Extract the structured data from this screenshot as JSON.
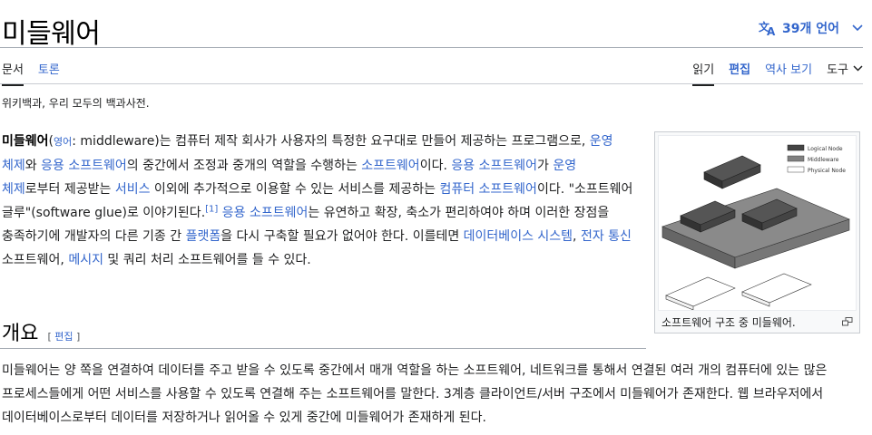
{
  "page": {
    "title": "미들웨어",
    "languages_label": "39개 언어",
    "tagline": "위키백과, 우리 모두의 백과사전."
  },
  "tabs": {
    "article": "문서",
    "talk": "토론",
    "read": "읽기",
    "edit": "편집",
    "history": "역사 보기",
    "tools": "도구"
  },
  "lead": {
    "term": "미들웨어",
    "p_open": "(",
    "english_link": "영어",
    "p_eng": ": middleware)는 컴퓨터 제작 회사가 사용자의 특정한 요구대로 만들어 제공하는 프로그램으로, ",
    "link_os1": "운영 체제",
    "p_and1": "와 ",
    "link_app1": "응용 소프트웨어",
    "p_mid1": "의 중간에서 조정과 중개의 역할을 수행하는 ",
    "link_sw1": "소프트웨어",
    "p_mid2": "이다. ",
    "link_app2": "응용 소프트웨어",
    "p_mid3": "가 ",
    "link_os2": "운영 체제",
    "p_mid4": "로부터 제공받는 ",
    "link_service": "서비스",
    "p_mid5": " 이외에 추가적으로 이용할 수 있는 서비스를 제공하는 ",
    "link_computer_sw": "컴퓨터 소프트웨어",
    "p_mid6": "이다. \"소프트웨어 글루\"(software glue)로 이야기된다.",
    "cite": "[1]",
    "p_space": " ",
    "link_app3": "응용 소프트웨어",
    "p_mid7": "는 유연하고 확장, 축소가 편리하여야 하며 이러한 장점을 충족하기에 개발자의 다른 기종 간 ",
    "link_platform": "플랫폼",
    "p_mid8": "을 다시 구축할 필요가 없어야 한다. 이를테면 ",
    "link_db": "데이터베이스 시스템",
    "p_comma": ", ",
    "link_ecomm": "전자 통신",
    "p_mid9": " 소프트웨어, ",
    "link_msg": "메시지",
    "p_end": " 및 쿼리 처리 소프트웨어를 들 수 있다."
  },
  "infobox": {
    "caption": "소프트웨어 구조 중 미들웨어.",
    "legend": [
      "Logical Node",
      "Middleware",
      "Physical Node"
    ]
  },
  "section": {
    "heading": "개요",
    "edit_open": "[ ",
    "edit_label": "편집",
    "edit_close": " ]",
    "paragraph": "미들웨어는 양 쪽을 연결하여 데이터를 주고 받을 수 있도록 중간에서 매개 역할을 하는 소프트웨어, 네트워크를 통해서 연결된 여러 개의 컴퓨터에 있는 많은 프로세스들에게 어떤 서비스를 사용할 수 있도록 연결해 주는 소프트웨어를 말한다. 3계층 클라이언트/서버 구조에서 미들웨어가 존재한다. 웹 브라우저에서 데이터베이스로부터 데이터를 저장하거나 읽어올 수 있게 중간에 미들웨어가 존재하게 된다."
  },
  "colors": {
    "link": "#3366cc",
    "text": "#202122",
    "logical_node": "#444444",
    "middleware": "#808080",
    "physical_node": "#ffffff"
  },
  "icons": [
    "translate-icon",
    "chevron-down-icon",
    "enlarge-icon"
  ]
}
